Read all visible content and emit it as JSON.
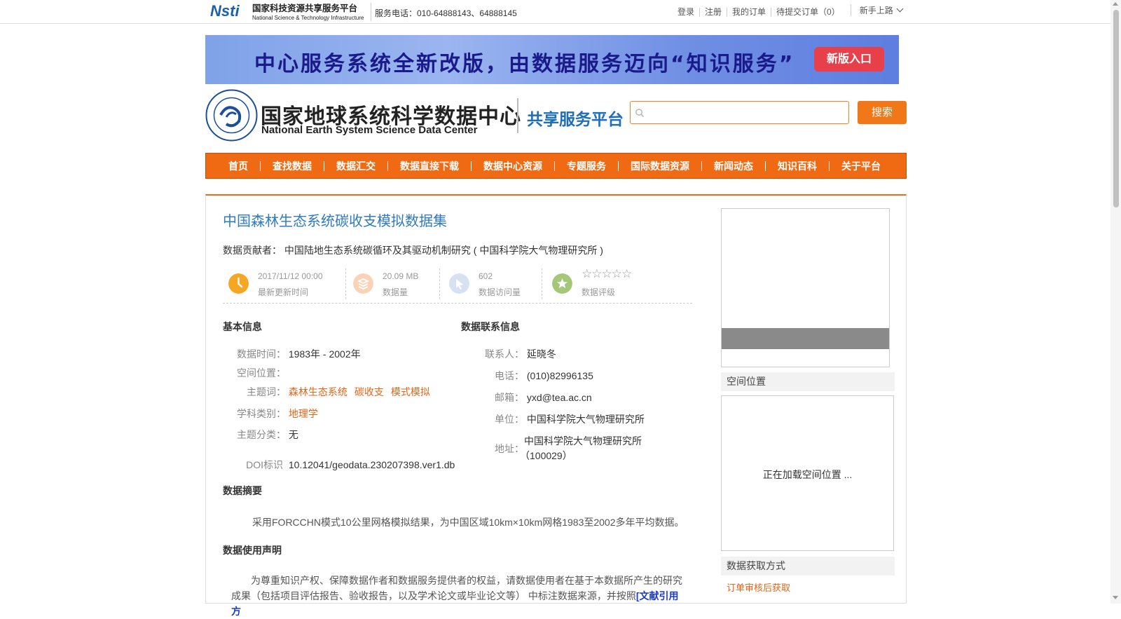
{
  "topbar": {
    "logo_cn": "国家科技资源共享服务平台",
    "logo_en": "National Science & Technology Infrastructure",
    "logo_mark": "Nsti",
    "phone": "服务电话：010-64888143、64888145",
    "links": [
      "登录",
      "注册",
      "我的订单",
      "待提交订单（0）"
    ],
    "newbie": "新手上路"
  },
  "banner": {
    "text": "中心服务系统全新改版，由数据服务迈向“知识服务”",
    "button": "新版入口"
  },
  "header": {
    "name_cn": "国家地球系统科学数据中心",
    "name_en": "National Earth System Science Data Center",
    "platform": "共享服务平台",
    "search_placeholder": "",
    "search_button": "搜索"
  },
  "nav": [
    "首页",
    "查找数据",
    "数据汇交",
    "数据直接下载",
    "数据中心资源",
    "专题服务",
    "国际数据资源",
    "新闻动态",
    "知识百科",
    "关于平台"
  ],
  "dataset": {
    "title": "中国森林生态系统碳收支模拟数据集",
    "contributor_label": "数据贡献者：",
    "contributor": "中国陆地生态系统碳循环及其驱动机制研究 ( 中国科学院大气物理研究所 )",
    "stats": {
      "updated": "2017/11/12 00:00",
      "updated_label": "最新更新时间",
      "size": "20.09 MB",
      "size_label": "数据量",
      "visits": "602",
      "visits_label": "数据访问量",
      "rating_stars": "☆☆☆☆☆",
      "rating_label": "数据评级"
    },
    "basic": {
      "heading": "基本信息",
      "time_label": "数据时间：",
      "time": "1983年 - 2002年",
      "space_label": "空间位置：",
      "keywords_label": "主题词：",
      "keywords": [
        "森林生态系统",
        "碳收支",
        "模式模拟"
      ],
      "subject_label": "学科类别：",
      "subject": "地理学",
      "category_label": "主题分类：",
      "category": "无",
      "doi_label": "DOI标识",
      "doi": "10.12041/geodata.230207398.ver1.db"
    },
    "contact": {
      "heading": "数据联系信息",
      "person_label": "联系人：",
      "person": "延晓冬",
      "phone_label": "电话：",
      "phone": "(010)82996135",
      "email_label": "邮箱：",
      "email": "yxd@tea.ac.cn",
      "org_label": "单位：",
      "org": "中国科学院大气物理研究所",
      "addr_label": "地址：",
      "addr_line1": "中国科学院大气物理研究所",
      "addr_line2": "（100029）"
    },
    "abstract_heading": "数据摘要",
    "abstract": "采用FORCCHN模式10公里网格模拟结果，为中国区域10km×10km网格1983至2002多年平均数据。",
    "usage_heading": "数据使用声明",
    "usage_text": "为尊重知识产权、保障数据作者和数据服务提供者的权益，请数据使用者在基于本数据所产生的研究成果（包括项目评估报告、验收报告，以及学术论文或毕业论文等） 中标注数据来源，并按照",
    "usage_link": "[文献引用方"
  },
  "side": {
    "space_heading": "空间位置",
    "map_loading": "正在加载空间位置 ...",
    "access_heading": "数据获取方式",
    "access_value": "订单审核后获取"
  },
  "colors": {
    "accent": "#f06a14",
    "title_blue": "#2f7bc0",
    "link_orange": "#e0661a"
  }
}
